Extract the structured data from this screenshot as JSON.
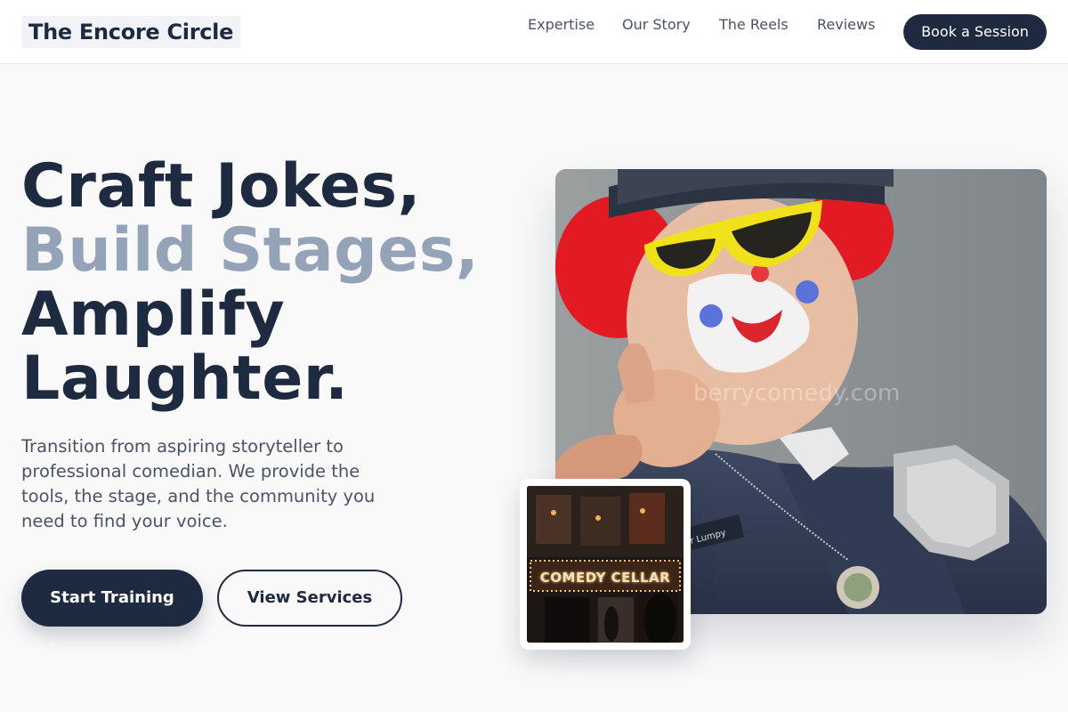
{
  "header": {
    "brand": "The Encore Circle",
    "nav": [
      "Expertise",
      "Our Story",
      "The Reels",
      "Reviews"
    ],
    "cta_label": "Book a Session"
  },
  "hero": {
    "title_lines": [
      "Craft Jokes,",
      "Build Stages,",
      "Amplify",
      "Laughter."
    ],
    "subtitle": "Transition from aspiring storyteller to professional comedian. We provide the tools, the stage, and the community you need to find your voice.",
    "primary_button": "Start Training",
    "secondary_button": "View Services",
    "main_image": {
      "subject": "clown in police uniform pointing at viewer",
      "watermark": "berrycomedy.com",
      "name_tag": "r Lumpy"
    },
    "inset_image": {
      "subject": "comedy club entrance with marquee sign",
      "sign_text": "COMEDY CELLAR"
    }
  },
  "colors": {
    "primary": "#1e2a3f",
    "accent_text": "#94a3b8",
    "body_text": "#4a5466",
    "page_bg": "#f9f9fa"
  }
}
